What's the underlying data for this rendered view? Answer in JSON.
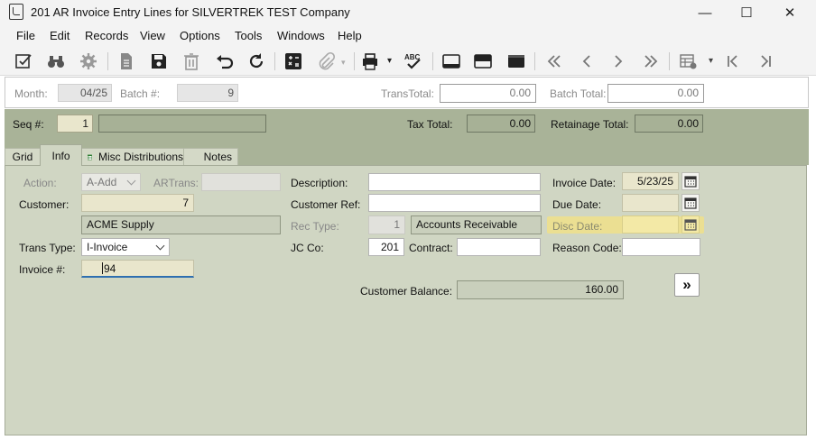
{
  "window": {
    "title": "201 AR Invoice Entry Lines for SILVERTREK TEST Company",
    "minimize_glyph": "—",
    "maximize_glyph": "☐",
    "close_glyph": "✕"
  },
  "menu": [
    "File",
    "Edit",
    "Records",
    "View",
    "Options",
    "Tools",
    "Windows",
    "Help"
  ],
  "toolbar_icons": [
    "edit-icon",
    "binoculars-icon",
    "settings-gear-icon",
    "document-icon",
    "save-icon",
    "delete-icon",
    "undo-icon",
    "refresh-icon",
    "calculator-icon",
    "attach-icon",
    "print-icon",
    "spellcheck-icon",
    "layout-bottom-icon",
    "layout-split-icon",
    "layout-top-icon",
    "first-record-icon",
    "previous-record-icon",
    "next-record-icon",
    "last-record-icon",
    "grid-settings-icon",
    "jump-first-icon",
    "jump-last-icon"
  ],
  "batch": {
    "month_label": "Month:",
    "month_value": "04/25",
    "batch_label": "Batch #:",
    "batch_value": "9",
    "trans_total_label": "TransTotal:",
    "trans_total_value": "0.00",
    "batch_total_label": "Batch Total:",
    "batch_total_value": "0.00"
  },
  "header": {
    "seq_label": "Seq #:",
    "seq_value": "1",
    "seq_desc": "",
    "tax_total_label": "Tax Total:",
    "tax_total_value": "0.00",
    "retainage_total_label": "Retainage Total:",
    "retainage_total_value": "0.00"
  },
  "tabs": [
    "Grid",
    "Info",
    "Misc Distributions",
    "Notes"
  ],
  "active_tab": "Info",
  "form": {
    "action_label": "Action:",
    "action_value": "A-Add",
    "artrans_label": "ARTrans:",
    "artrans_value": "",
    "customer_label": "Customer:",
    "customer_value": "7",
    "customer_name": "ACME Supply",
    "trans_type_label": "Trans Type:",
    "trans_type_value": "I-Invoice",
    "invoice_label": "Invoice #:",
    "invoice_value": "94",
    "description_label": "Description:",
    "description_value": "",
    "customer_ref_label": "Customer Ref:",
    "customer_ref_value": "",
    "rec_type_label": "Rec Type:",
    "rec_type_value": "1",
    "rec_type_desc": "Accounts Receivable",
    "jc_co_label": "JC Co:",
    "jc_co_value": "201",
    "contract_label": "Contract:",
    "contract_value": "",
    "invoice_date_label": "Invoice Date:",
    "invoice_date_value": "5/23/25",
    "due_date_label": "Due Date:",
    "due_date_value": "",
    "disc_date_label": "Disc Date:",
    "disc_date_value": "",
    "reason_code_label": "Reason Code:",
    "reason_code_value": "",
    "customer_balance_label": "Customer Balance:",
    "customer_balance_value": "160.00",
    "more_button": "»"
  },
  "colors": {
    "panel_bg": "#d0d6c3",
    "header_bg": "#a9b398",
    "highlight": "#f0e08a",
    "focus_underline": "#2f6fb0"
  }
}
